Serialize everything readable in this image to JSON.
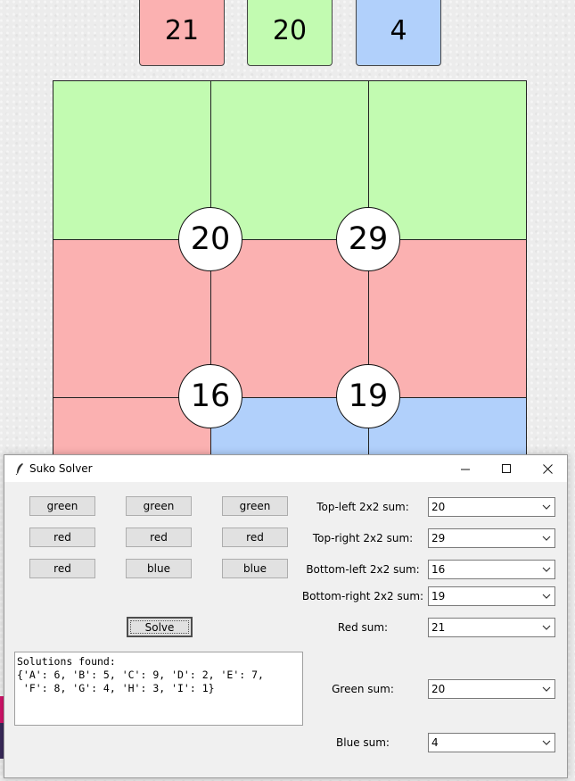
{
  "totals": [
    {
      "value": "21",
      "color": "#fbb1b1"
    },
    {
      "value": "20",
      "color": "#c2fbb1"
    },
    {
      "value": "4",
      "color": "#b1d0fb"
    }
  ],
  "board": {
    "colors": {
      "red": "#fbb1b1",
      "green": "#c2fbb1",
      "blue": "#b1d0fb"
    },
    "cells": [
      [
        "green",
        "green",
        "green"
      ],
      [
        "red",
        "red",
        "red"
      ],
      [
        "red",
        "blue",
        "blue"
      ]
    ],
    "circles": [
      "20",
      "29",
      "16",
      "19"
    ]
  },
  "window": {
    "title": "Suko Solver",
    "controls": {
      "minimize": "—",
      "maximize": "☐",
      "close": "✕"
    }
  },
  "color_buttons": [
    [
      "green",
      "green",
      "green"
    ],
    [
      "red",
      "red",
      "red"
    ],
    [
      "red",
      "blue",
      "blue"
    ]
  ],
  "fields": [
    {
      "label": "Top-left 2x2 sum:",
      "value": "20"
    },
    {
      "label": "Top-right 2x2 sum:",
      "value": "29"
    },
    {
      "label": "Bottom-left 2x2 sum:",
      "value": "16"
    },
    {
      "label": "Bottom-right 2x2 sum:",
      "value": "19"
    },
    {
      "label": "Red sum:",
      "value": "21"
    },
    {
      "label": "Green sum:",
      "value": "20"
    },
    {
      "label": "Blue sum:",
      "value": "4"
    }
  ],
  "solve_label": "Solve",
  "output": {
    "line1": "Solutions found:",
    "line2": "{'A': 6, 'B': 5, 'C': 9, 'D': 2, 'E': 7,",
    "line3": " 'F': 8, 'G': 4, 'H': 3, 'I': 1}"
  }
}
